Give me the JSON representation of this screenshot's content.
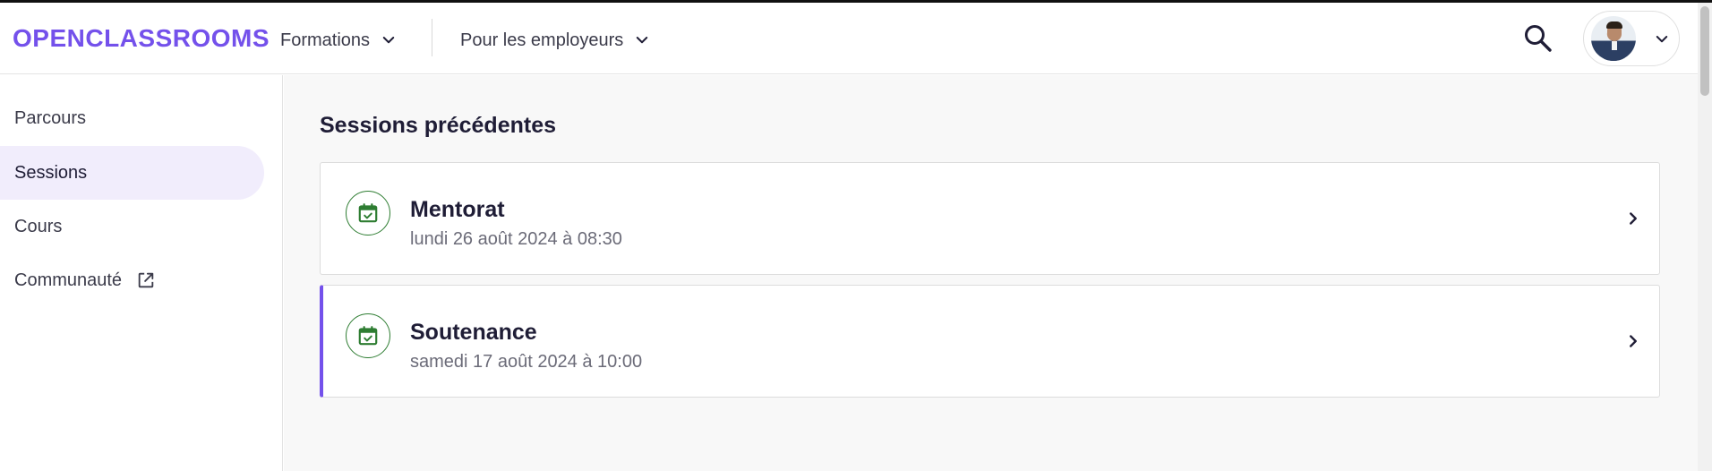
{
  "header": {
    "logo_text": "OPENCLASSROOMS",
    "nav": [
      {
        "label": "Formations"
      },
      {
        "label": "Pour les employeurs"
      }
    ]
  },
  "sidebar": {
    "items": [
      {
        "label": "Parcours",
        "active": false
      },
      {
        "label": "Sessions",
        "active": true
      },
      {
        "label": "Cours",
        "active": false
      },
      {
        "label": "Communauté",
        "active": false,
        "icon": "external-link-icon"
      }
    ]
  },
  "main": {
    "title": "Sessions précédentes",
    "sessions": [
      {
        "title": "Mentorat",
        "date": "lundi 26 août 2024 à 08:30",
        "icon": "calendar-check-icon"
      },
      {
        "title": "Soutenance",
        "date": "samedi 17 août 2024 à 10:00",
        "icon": "calendar-check-icon"
      }
    ]
  },
  "colors": {
    "brand": "#7451eb",
    "icon_green": "#2e7d32",
    "active_bg": "#f1edfc"
  }
}
